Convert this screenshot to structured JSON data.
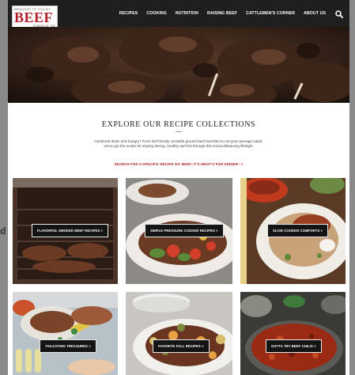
{
  "header": {
    "logo": {
      "top": "BROUGHT TO YOU BY",
      "brand": "BEEF",
      "bottom": "FUNDED BY THE"
    },
    "nav": [
      "RECIPES",
      "COOKING",
      "NUTRITION",
      "RAISING BEEF",
      "CATTLEMEN'S CORNER",
      "ABOUT US"
    ],
    "search_icon": "search-icon"
  },
  "intro": {
    "title": "EXPLORE OUR RECIPE COLLECTIONS",
    "body": "Hunkered down and hungry? From kid-friendly, versatile ground beef favorites to not-your-average salad, we've got the recipe for staying strong, healthy and fed through this social distancing lifestyle.",
    "link": "SEARCH FOR A SPECIFIC RECIPE ON 'BEEF. IT'S WHAT'S FOR DINNER.' >"
  },
  "tiles": [
    {
      "label": "FLAVORFUL SMOKED BEEF RECIPES >"
    },
    {
      "label": "SIMPLE PRESSURE COOKER RECIPES >"
    },
    {
      "label": "SLOW COOKER COMFORTS >"
    },
    {
      "label": "TAILGATING TREASURES >"
    },
    {
      "label": "FAVORITE FALL RECIPES >"
    },
    {
      "label": "GOTTA TRY BEEF CHILIS >"
    }
  ],
  "colors": {
    "brand_red": "#b3202a",
    "header_bg": "#1f1f1f",
    "button_bg": "#141414"
  }
}
